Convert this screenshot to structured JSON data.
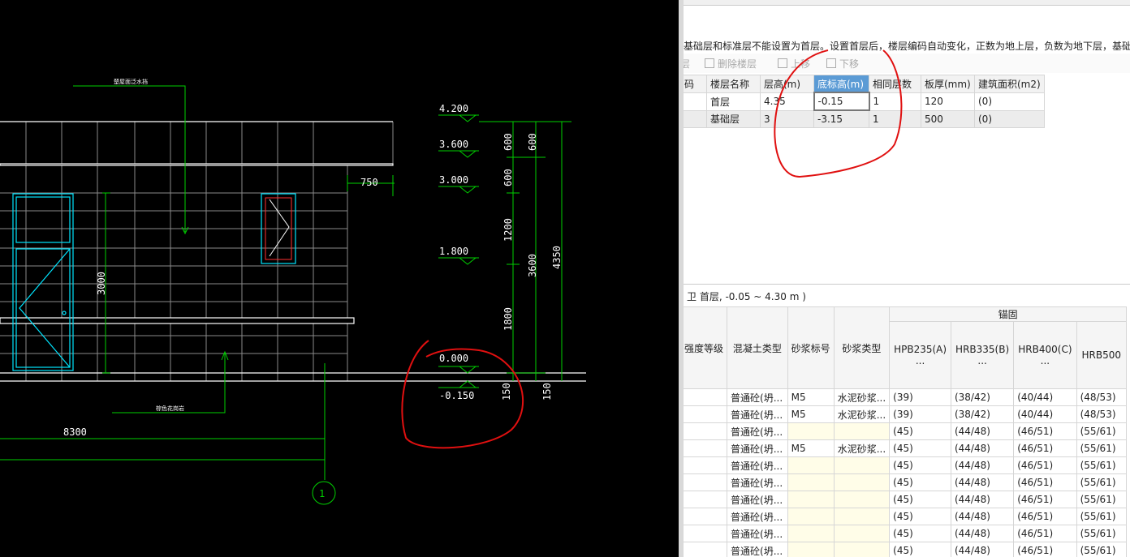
{
  "cad": {
    "annot_top": "楚屋面泛水挡",
    "annot_bottom": "棕色花岗岩",
    "dim_750": "750",
    "dim_3000": "3000",
    "dim_8300": "8300",
    "axis_label": "1",
    "levels": [
      "4.200",
      "3.600",
      "3.000",
      "1.800",
      "0.000",
      "-0.150"
    ],
    "dims_inner": [
      "600",
      "600",
      "1200",
      "1800",
      "150"
    ],
    "dims_mid": [
      "600",
      "3600",
      "150"
    ],
    "dim_total": "4350"
  },
  "panel": {
    "hint": "基础层和标准层不能设置为首层。设置首层后，楼层编码自动变化，正数为地上层，负数为地下层，基础层",
    "toolbar": {
      "left_stub": "层",
      "delete_floor": "删除楼层",
      "move_up": "上移",
      "move_down": "下移"
    },
    "floor_headers": [
      "码",
      "楼层名称",
      "层高(m)",
      "底标高(m)",
      "相同层数",
      "板厚(mm)",
      "建筑面积(m2)"
    ],
    "floors": [
      [
        "",
        "首层",
        "4.35",
        "-0.15",
        "1",
        "120",
        "(0)"
      ],
      [
        "",
        "基础层",
        "3",
        "-3.15",
        "1",
        "500",
        "(0)"
      ]
    ],
    "section_title": "卫 首层, -0.05 ~ 4.30 m )",
    "mat_group": "锚固",
    "mat_headers": [
      "强度等级",
      "混凝土类型",
      "砂浆标号",
      "砂浆类型",
      "HPB235(A) ...",
      "HRB335(B) ...",
      "HRB400(C) ...",
      "HRB500"
    ],
    "mat_rows": [
      [
        "",
        "普通砼(坍...",
        "M5",
        "水泥砂浆...",
        "(39)",
        "(38/42)",
        "(40/44)",
        "(48/53)"
      ],
      [
        "",
        "普通砼(坍...",
        "M5",
        "水泥砂浆...",
        "(39)",
        "(38/42)",
        "(40/44)",
        "(48/53)"
      ],
      [
        "",
        "普通砼(坍...",
        "",
        "",
        "(45)",
        "(44/48)",
        "(46/51)",
        "(55/61)"
      ],
      [
        "",
        "普通砼(坍...",
        "M5",
        "水泥砂浆...",
        "(45)",
        "(44/48)",
        "(46/51)",
        "(55/61)"
      ],
      [
        "",
        "普通砼(坍...",
        "",
        "",
        "(45)",
        "(44/48)",
        "(46/51)",
        "(55/61)"
      ],
      [
        "",
        "普通砼(坍...",
        "",
        "",
        "(45)",
        "(44/48)",
        "(46/51)",
        "(55/61)"
      ],
      [
        "",
        "普通砼(坍...",
        "",
        "",
        "(45)",
        "(44/48)",
        "(46/51)",
        "(55/61)"
      ],
      [
        "",
        "普通砼(坍...",
        "",
        "",
        "(45)",
        "(44/48)",
        "(46/51)",
        "(55/61)"
      ],
      [
        "",
        "普通砼(坍...",
        "",
        "",
        "(45)",
        "(44/48)",
        "(46/51)",
        "(55/61)"
      ],
      [
        "",
        "普通砼(坍...",
        "",
        "",
        "(45)",
        "(44/48)",
        "(46/51)",
        "(55/61)"
      ]
    ],
    "colors": {
      "header_highlight": "#5b9bd5",
      "annotation_red": "#e01010",
      "cad_green": "#00d000",
      "cad_cyan": "#00e5ff"
    }
  }
}
